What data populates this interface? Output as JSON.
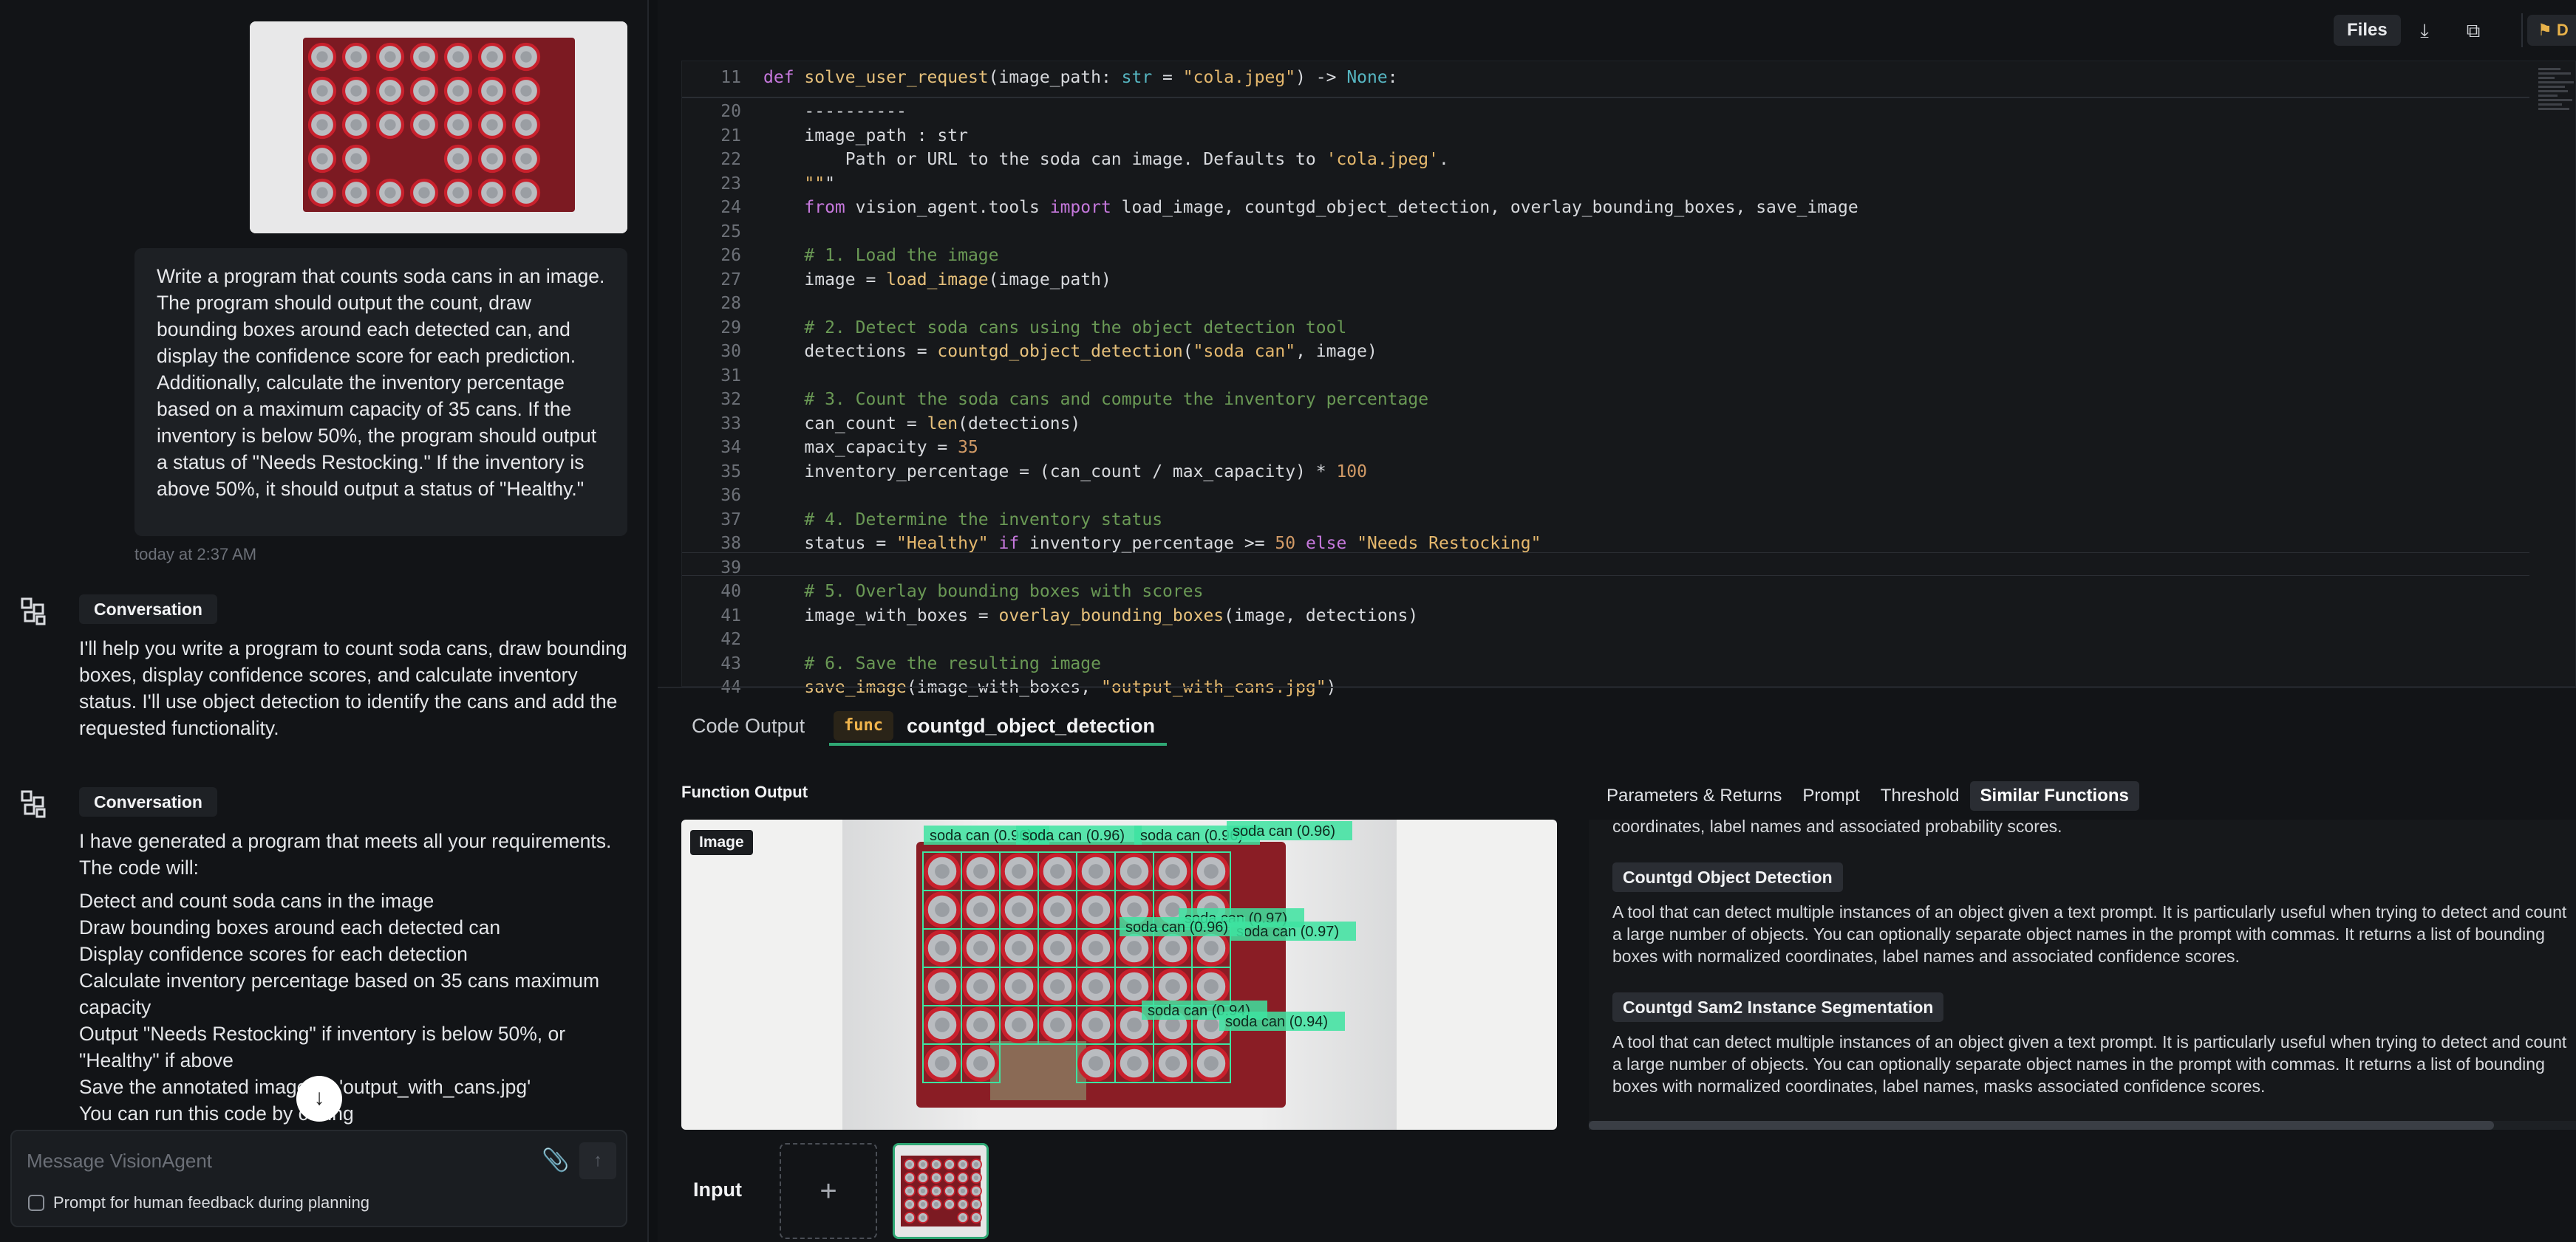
{
  "chat": {
    "user_prompt": "Write a program that counts soda cans in an image. The program should output the count, draw bounding boxes around each detected can, and display the confidence score for each prediction. Additionally, calculate the inventory percentage based on a maximum capacity of 35 cans. If the inventory is below 50%, the program should output a status of \"Needs Restocking.\" If the inventory is above 50%, it should output a status of \"Healthy.\"",
    "timestamp": "today at 2:37 AM",
    "messages": [
      {
        "tag": "Conversation",
        "text": "I'll help you write a program to count soda cans, draw bounding boxes, display confidence scores, and calculate inventory status. I'll use object detection to identify the cans and add the requested functionality."
      },
      {
        "tag": "Conversation",
        "text": "I have generated a program that meets all your requirements. The code will:",
        "items": [
          "Detect and count soda cans in the image",
          "Draw bounding boxes around each detected can",
          "Display confidence scores for each detection",
          "Calculate inventory percentage based on 35 cans maximum capacity",
          "Output \"Needs Restocking\" if inventory is below 50%, or \"Healthy\" if above",
          "Save the annotated image as 'output_with_cans.jpg'",
          "You can run this code by calling"
        ]
      }
    ],
    "composer": {
      "placeholder": "Message VisionAgent",
      "human_feedback_label": "Prompt for human feedback during planning"
    }
  },
  "topbar": {
    "files_label": "Files",
    "deploy_label": "D"
  },
  "editor": {
    "sticky_line_no": "11",
    "sticky_code": "def solve_user_request(image_path: str = \"cola.jpeg\") -> None:",
    "lines": [
      {
        "no": "20",
        "code": "    ----------"
      },
      {
        "no": "21",
        "code": "    image_path : str"
      },
      {
        "no": "22",
        "code": "        Path or URL to the soda can image. Defaults to 'cola.jpeg'."
      },
      {
        "no": "23",
        "code": "    \"\"\""
      },
      {
        "no": "24",
        "code": "    from vision_agent.tools import load_image, countgd_object_detection, overlay_bounding_boxes, save_image"
      },
      {
        "no": "25",
        "code": ""
      },
      {
        "no": "26",
        "code": "    # 1. Load the image"
      },
      {
        "no": "27",
        "code": "    image = load_image(image_path)"
      },
      {
        "no": "28",
        "code": ""
      },
      {
        "no": "29",
        "code": "    # 2. Detect soda cans using the object detection tool"
      },
      {
        "no": "30",
        "code": "    detections = countgd_object_detection(\"soda can\", image)"
      },
      {
        "no": "31",
        "code": ""
      },
      {
        "no": "32",
        "code": "    # 3. Count the soda cans and compute the inventory percentage"
      },
      {
        "no": "33",
        "code": "    can_count = len(detections)"
      },
      {
        "no": "34",
        "code": "    max_capacity = 35"
      },
      {
        "no": "35",
        "code": "    inventory_percentage = (can_count / max_capacity) * 100"
      },
      {
        "no": "36",
        "code": ""
      },
      {
        "no": "37",
        "code": "    # 4. Determine the inventory status"
      },
      {
        "no": "38",
        "code": "    status = \"Healthy\" if inventory_percentage >= 50 else \"Needs Restocking\""
      },
      {
        "no": "39",
        "code": ""
      },
      {
        "no": "40",
        "code": "    # 5. Overlay bounding boxes with scores"
      },
      {
        "no": "41",
        "code": "    image_with_boxes = overlay_bounding_boxes(image, detections)"
      },
      {
        "no": "42",
        "code": ""
      },
      {
        "no": "43",
        "code": "    # 6. Save the resulting image"
      },
      {
        "no": "44",
        "code": "    save_image(image_with_boxes, \"output_with_cans.jpg\")"
      }
    ]
  },
  "tabs": {
    "code_output": "Code Output",
    "func_badge": "func",
    "func_name": "countgd_object_detection"
  },
  "output": {
    "title": "Function Output",
    "image_label": "Image",
    "detection_labels": [
      "soda can (0.96)",
      "soda can (0.96)",
      "soda can (0.96)",
      "soda can (0.96)",
      "soda can (0.97)",
      "soda can (0.97)",
      "soda can (0.96)",
      "soda can (0.94)",
      "soda can (0.94)"
    ]
  },
  "input_row": {
    "label": "Input",
    "add_symbol": "+"
  },
  "panel": {
    "tabs": [
      "Parameters & Returns",
      "Prompt",
      "Threshold",
      "Similar Functions"
    ],
    "clipped_text": "coordinates, label names and associated probability scores.",
    "similar": [
      {
        "name": "Countgd Object Detection",
        "desc": "A tool that can detect multiple instances of an object given a text prompt. It is particularly useful when trying to detect and count a large number of objects. You can optionally separate object names in the prompt with commas. It returns a list of bounding boxes with normalized coordinates, label names and associated confidence scores."
      },
      {
        "name": "Countgd Sam2 Instance Segmentation",
        "desc": "A tool that can detect multiple instances of an object given a text prompt. It is particularly useful when trying to detect and count a large number of objects. You can optionally separate object names in the prompt with commas. It returns a list of bounding boxes with normalized coordinates, label names, masks associated confidence scores."
      }
    ]
  },
  "colors": {
    "accent_green": "#2fa774",
    "func_orange": "#f0b44c",
    "box_green": "#3de3a0"
  },
  "icons": [
    "vision-agent-logo-icon",
    "paperclip-icon",
    "send-arrow-icon",
    "download-icon",
    "copy-icon",
    "deploy-icon",
    "arrow-down-icon",
    "plus-icon"
  ]
}
